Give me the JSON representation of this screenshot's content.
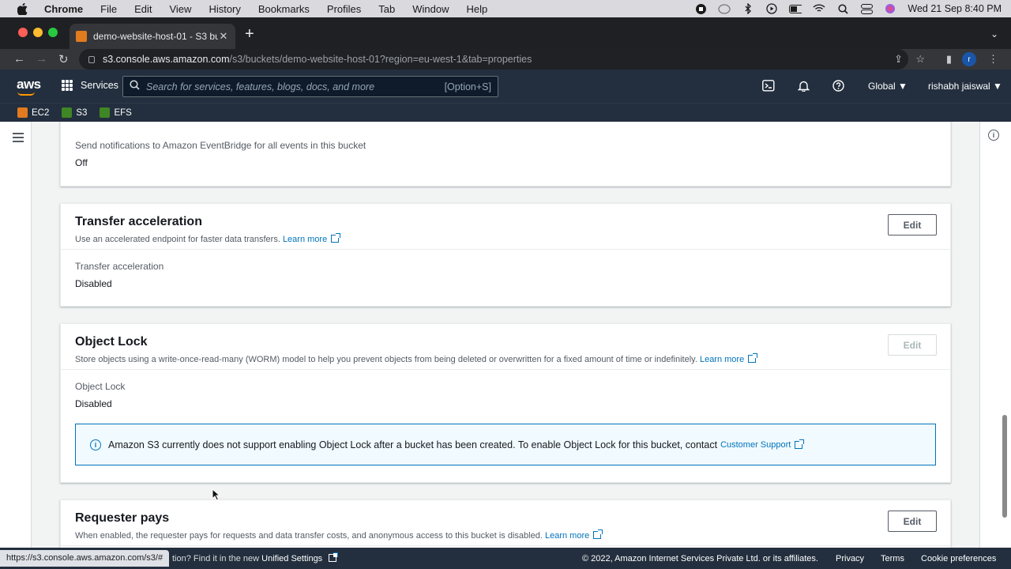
{
  "macos": {
    "menu": [
      "Chrome",
      "File",
      "Edit",
      "View",
      "History",
      "Bookmarks",
      "Profiles",
      "Tab",
      "Window",
      "Help"
    ],
    "clock": "Wed 21 Sep  8:40 PM"
  },
  "browser": {
    "tab_title": "demo-website-host-01 - S3 bu",
    "url_host": "s3.console.aws.amazon.com",
    "url_path": "/s3/buckets/demo-website-host-01?region=eu-west-1&tab=properties",
    "profile_initial": "r"
  },
  "aws_header": {
    "logo": "aws",
    "services_label": "Services",
    "search_placeholder": "Search for services, features, blogs, docs, and more",
    "search_shortcut": "[Option+S]",
    "region": "Global",
    "user": "rishabh jaiswal"
  },
  "favorites": [
    {
      "label": "EC2",
      "color": "#e07b1f"
    },
    {
      "label": "S3",
      "color": "#3f8624"
    },
    {
      "label": "EFS",
      "color": "#3f8624"
    }
  ],
  "colors": {
    "accent": "#0073bb",
    "header_bg": "#232f3e"
  },
  "panels": {
    "eventbridge": {
      "label": "Send notifications to Amazon EventBridge for all events in this bucket",
      "value": "Off"
    },
    "transfer": {
      "title": "Transfer acceleration",
      "desc": "Use an accelerated endpoint for faster data transfers.",
      "learn_more": "Learn more",
      "edit": "Edit",
      "label": "Transfer acceleration",
      "value": "Disabled"
    },
    "objectlock": {
      "title": "Object Lock",
      "desc": "Store objects using a write-once-read-many (WORM) model to help you prevent objects from being deleted or overwritten for a fixed amount of time or indefinitely.",
      "learn_more": "Learn more",
      "edit": "Edit",
      "label": "Object Lock",
      "value": "Disabled",
      "alert_text": "Amazon S3 currently does not support enabling Object Lock after a bucket has been created. To enable Object Lock for this bucket, contact",
      "alert_link": "Customer Support"
    },
    "requester": {
      "title": "Requester pays",
      "desc": "When enabled, the requester pays for requests and data transfer costs, and anonymous access to this bucket is disabled.",
      "learn_more": "Learn more",
      "edit": "Edit"
    }
  },
  "footer": {
    "status_url": "https://s3.console.aws.amazon.com/s3/#",
    "question_tail": "tion? Find it in the new",
    "unified_settings": "Unified Settings",
    "copyright": "© 2022, Amazon Internet Services Private Ltd. or its affiliates.",
    "privacy": "Privacy",
    "terms": "Terms",
    "cookie": "Cookie preferences"
  }
}
